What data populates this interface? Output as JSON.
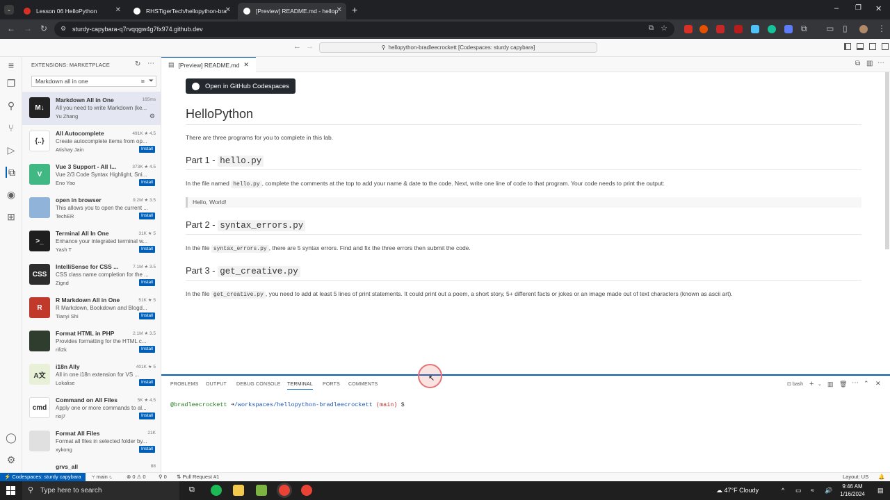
{
  "browser": {
    "tabs": [
      {
        "label": "Lesson 06 HelloPython",
        "color": "#d93025"
      },
      {
        "label": "RHSTigerTech/hellopython-bra",
        "color": "#ffffff"
      },
      {
        "label": "[Preview] README.md - hellop",
        "color": "#ffffff"
      }
    ],
    "url": "sturdy-capybara-q7rvqqgw4g7fx974.github.dev"
  },
  "vscode": {
    "command_center": "hellopython-bradleecrockett [Codespaces: sturdy capybara]",
    "sidebar": {
      "title": "EXTENSIONS: MARKETPLACE",
      "search_value": "Markdown all in one",
      "extensions": [
        {
          "name": "Markdown All in One",
          "desc": "All you need to write Markdown (ke...",
          "publisher": "Yu Zhang",
          "stats": "165ms",
          "button": "",
          "icon": "M↓",
          "icon_color": "#222222"
        },
        {
          "name": "All Autocomplete",
          "desc": "Create autocomplete items from op...",
          "publisher": "Atishay Jain",
          "stats": "491K ★ 4.5",
          "button": "Install",
          "icon": "{..}",
          "icon_color": "#ffffff"
        },
        {
          "name": "Vue 3 Support - All I...",
          "desc": "Vue 2/3 Code Syntax Highlight, Sni...",
          "publisher": "Eno Yao",
          "stats": "373K ★ 4.5",
          "button": "Install",
          "icon": "V",
          "icon_color": "#41b883"
        },
        {
          "name": "open in browser",
          "desc": "This allows you to open the current ...",
          "publisher": "TechER",
          "stats": "9.2M ★ 3.5",
          "button": "Install",
          "icon": "",
          "icon_color": "#8fb3d9"
        },
        {
          "name": "Terminal All In One",
          "desc": "Enhance your integrated terminal w...",
          "publisher": "Yash T",
          "stats": "31K ★ 5",
          "button": "Install",
          "icon": ">_",
          "icon_color": "#1e1e1e"
        },
        {
          "name": "IntelliSense for CSS ...",
          "desc": "CSS class name completion for the ...",
          "publisher": "Zignd",
          "stats": "7.1M ★ 3.5",
          "button": "Install",
          "icon": "CSS",
          "icon_color": "#2d2d2d"
        },
        {
          "name": "R Markdown All in One",
          "desc": "R Markdown, Bookdown and Blogd...",
          "publisher": "Tianyi Shi",
          "stats": "51K ★ 5",
          "button": "Install",
          "icon": "R",
          "icon_color": "#c0392b"
        },
        {
          "name": "Format HTML in PHP",
          "desc": "Provides formatting for the HTML c...",
          "publisher": "rifi2k",
          "stats": "2.1M ★ 3.5",
          "button": "Install",
          "icon": "",
          "icon_color": "#2f3d2f"
        },
        {
          "name": "i18n Ally",
          "desc": "All in one i18n extension for VS ...",
          "publisher": "Lokalise",
          "stats": "401K ★ 5",
          "button": "Install",
          "icon": "A文",
          "icon_color": "#e8f0d8"
        },
        {
          "name": "Command on All Files",
          "desc": "Apply one or more commands to al...",
          "publisher": "rioj7",
          "stats": "5K ★ 4.5",
          "button": "Install",
          "icon": "cmd",
          "icon_color": "#ffffff"
        },
        {
          "name": "Format All Files",
          "desc": "Format all files in selected folder by...",
          "publisher": "xykong",
          "stats": "21K",
          "button": "Install",
          "icon": "",
          "icon_color": "#e0e0e0"
        },
        {
          "name": "grvs_all",
          "desc": "",
          "publisher": "",
          "stats": "88",
          "button": "",
          "icon": "",
          "icon_color": "#f8f8f8"
        }
      ]
    },
    "editor_tab": "[Preview] README.md",
    "preview": {
      "button": "Open in GitHub Codespaces",
      "title": "HelloPython",
      "intro": "There are three programs for you to complete in this lab.",
      "part1_prefix": "Part 1 - ",
      "part1_code": "hello.py",
      "part1_text_a": "In the file named ",
      "part1_text_code": "hello.py",
      "part1_text_b": ", complete the comments at the top to add your name & date to the code. Next, write one line of code to that program. Your code needs to print the output:",
      "part1_quote": "Hello, World!",
      "part2_prefix": "Part 2 - ",
      "part2_code": "syntax_errors.py",
      "part2_text_a": "In the file ",
      "part2_text_code": "syntax_errors.py",
      "part2_text_b": ", there are 5 syntax errors. Find and fix the three errors then submit the code.",
      "part3_prefix": "Part 3 - ",
      "part3_code": "get_creative.py",
      "part3_text_a": "In the file ",
      "part3_text_code": "get_creative.py",
      "part3_text_b": ", you need to add at least 5 lines of print statements. It could print out a poem, a short story, 5+ different facts or jokes or an image made out of text characters (known as ascii art)."
    },
    "panel": {
      "tabs": [
        "PROBLEMS",
        "OUTPUT",
        "DEBUG CONSOLE",
        "TERMINAL",
        "PORTS",
        "COMMENTS"
      ],
      "shell": "bash",
      "prompt_user": "@bradleecrockett",
      "prompt_arrow": "➜",
      "prompt_path": "/workspaces/hellopython-bradleecrockett",
      "prompt_branch": "(main)",
      "prompt_symbol": "$"
    },
    "statusbar": {
      "remote": "Codespaces: sturdy capybara",
      "branch": "main",
      "problems": "⊗ 0 ⚠ 0",
      "ports": "⚲ 0",
      "pr": "Pull Request #1",
      "layout": "Layout: US"
    }
  },
  "taskbar": {
    "search_placeholder": "Type here to search",
    "weather": "47°F  Cloudy",
    "time": "9:46 AM",
    "date": "1/16/2024"
  },
  "colors": {
    "accent": "#005fb8",
    "code_bg": "#f2f2f2"
  }
}
